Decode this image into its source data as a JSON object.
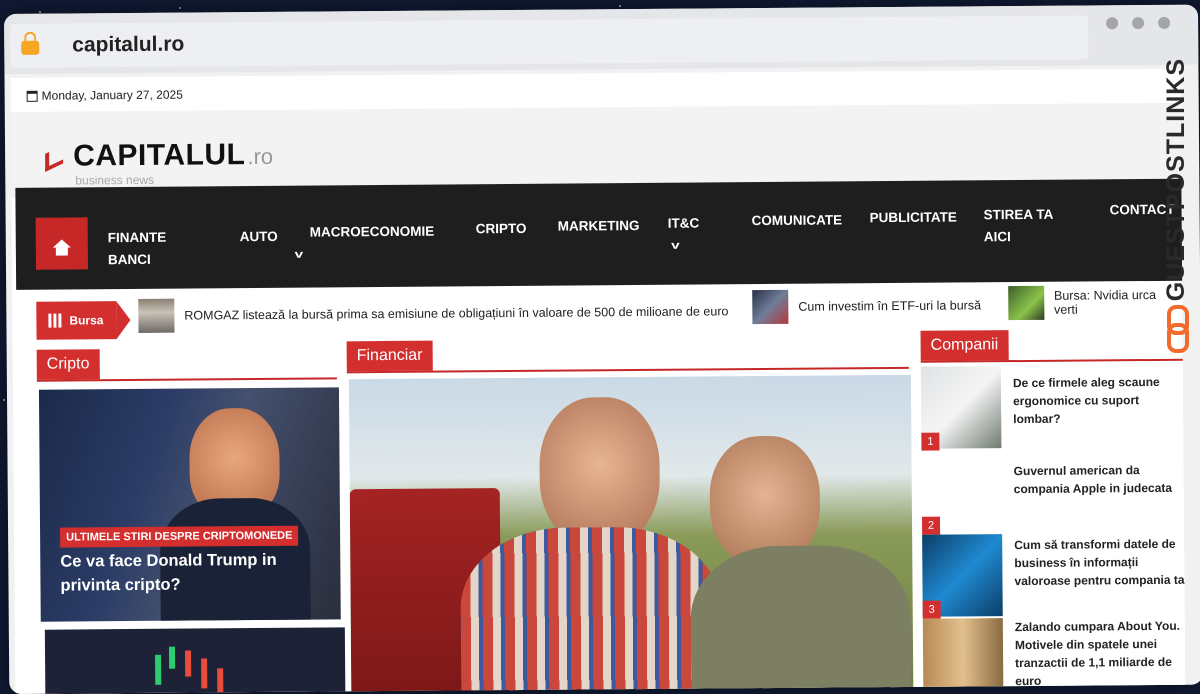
{
  "browser": {
    "url": "capitalul.ro"
  },
  "page": {
    "date": "Monday, January 27, 2025",
    "logo": {
      "main": "CAPITALUL",
      "tld": ".ro",
      "tagline": "business news"
    },
    "nav": {
      "items": [
        {
          "label": "FINANTE BANCI",
          "dropdown": false
        },
        {
          "label": "AUTO",
          "dropdown": false
        },
        {
          "label": "MACROECONOMIE",
          "dropdown": true
        },
        {
          "label": "CRIPTO",
          "dropdown": false
        },
        {
          "label": "MARKETING",
          "dropdown": false
        },
        {
          "label": "IT&C",
          "dropdown": true
        },
        {
          "label": "COMUNICATE",
          "dropdown": false
        },
        {
          "label": "PUBLICITATE",
          "dropdown": false
        },
        {
          "label": "STIREA TA AICI",
          "dropdown": false
        },
        {
          "label": "CONTACT",
          "dropdown": false
        }
      ]
    },
    "ticker": {
      "label": "Bursa",
      "items": [
        "ROMGAZ listează la bursă prima sa emisiune de obligațiuni în valoare de 500 de milioane de euro",
        "Cum investim în ETF-uri la bursă",
        "Bursa: Nvidia urca verti"
      ]
    },
    "sections": {
      "cripto": {
        "title": "Cripto",
        "featured": {
          "badge": "ULTIMELE STIRI DESPRE CRIPTOMONEDE",
          "title": "Ce va face Donald Trump in privinta cripto?"
        }
      },
      "financiar": {
        "title": "Financiar"
      },
      "companii": {
        "title": "Companii",
        "items": [
          {
            "num": "1",
            "title": "De ce firmele aleg scaune ergonomice cu suport lombar?"
          },
          {
            "num": "2",
            "title": "Guvernul american da compania Apple in judecata"
          },
          {
            "num": "3",
            "title": "Cum să transformi datele de business în informații valoroase pentru compania ta"
          },
          {
            "num": "",
            "title": "Zalando cumpara About You. Motivele din spatele unei tranzactii de 1,1 miliarde de euro"
          }
        ]
      }
    }
  },
  "watermark": {
    "text": "GUESTPOSTLINKS"
  },
  "colors": {
    "accent": "#d32f2f",
    "nav_bg": "#1e1e1e",
    "watermark_link": "#f26b2d"
  }
}
